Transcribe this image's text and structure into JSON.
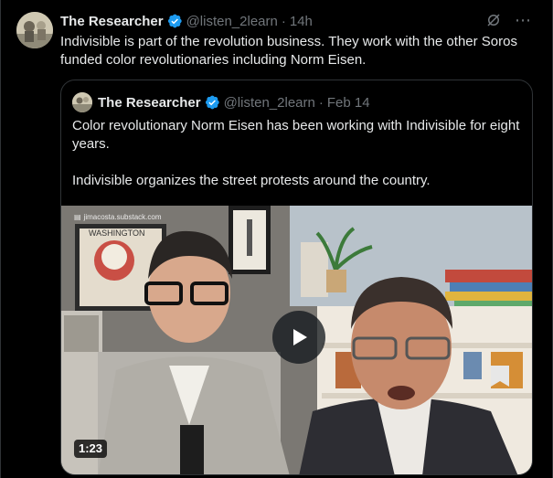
{
  "tweet": {
    "author_name": "The Researcher",
    "handle": "@listen_2learn",
    "separator": "·",
    "time": "14h",
    "text": "Indivisible is part of the revolution business. They work with the other Soros funded color revolutionaries including Norm Eisen.",
    "icons": {
      "verified": "verified-badge-icon",
      "grok": "grok-icon",
      "more": "more-icon"
    },
    "colors": {
      "verified": "#1d9bf0",
      "muted": "#71767b",
      "text": "#e7e9ea",
      "border": "#2f3336"
    }
  },
  "quote": {
    "author_name": "The Researcher",
    "handle": "@listen_2learn",
    "separator": "·",
    "date": "Feb 14",
    "paragraph_1": "Color revolutionary Norm Eisen has been working with Indivisible for eight years.",
    "paragraph_2": "Indivisible organizes the street protests around the country.",
    "video": {
      "watermark": "jimacosta.substack.com",
      "duration": "1:23",
      "poster_sign": "WASHINGTON"
    }
  }
}
